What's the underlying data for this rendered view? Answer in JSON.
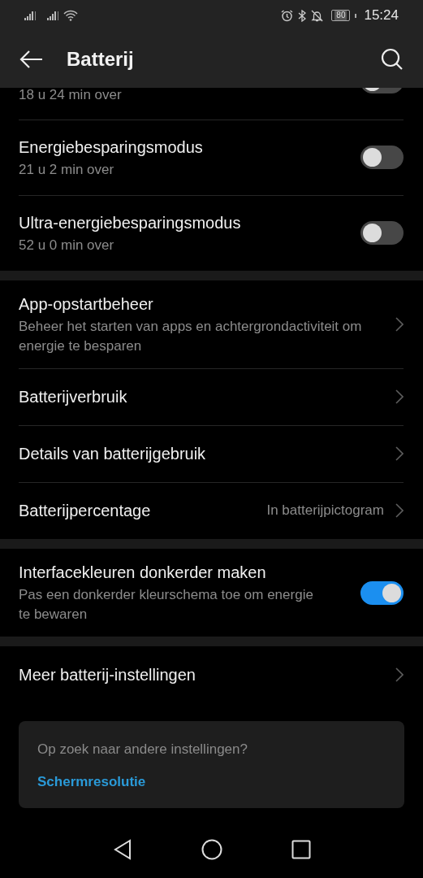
{
  "status_bar": {
    "battery": "80",
    "time": "15:24"
  },
  "app_bar": {
    "title": "Batterij"
  },
  "sections": [
    {
      "items": [
        {
          "kind": "toggle",
          "subtitle": "18 u 24 min over",
          "checked": false,
          "cut": true
        },
        {
          "kind": "toggle",
          "title": "Energiebesparingsmodus",
          "subtitle": "21 u 2 min over",
          "checked": false
        },
        {
          "kind": "toggle",
          "title": "Ultra-energiebesparingsmodus",
          "subtitle": "52 u 0 min over",
          "checked": false
        }
      ]
    },
    {
      "items": [
        {
          "kind": "link",
          "title": "App-opstartbeheer",
          "subtitle": "Beheer het starten van apps en achtergrondactiviteit om energie te besparen"
        },
        {
          "kind": "link",
          "title": "Batterijverbruik"
        },
        {
          "kind": "link",
          "title": "Details van batterijgebruik"
        },
        {
          "kind": "link",
          "title": "Batterijpercentage",
          "value": "In batterijpictogram"
        }
      ]
    },
    {
      "items": [
        {
          "kind": "toggle",
          "title": "Interfacekleuren donkerder maken",
          "subtitle": "Pas een donkerder kleurschema toe om energie te bewaren",
          "checked": true
        }
      ]
    },
    {
      "items": [
        {
          "kind": "link",
          "title": "Meer batterij-instellingen"
        }
      ]
    }
  ],
  "suggestion": {
    "question": "Op zoek naar andere instellingen?",
    "link": "Schermresolutie"
  }
}
